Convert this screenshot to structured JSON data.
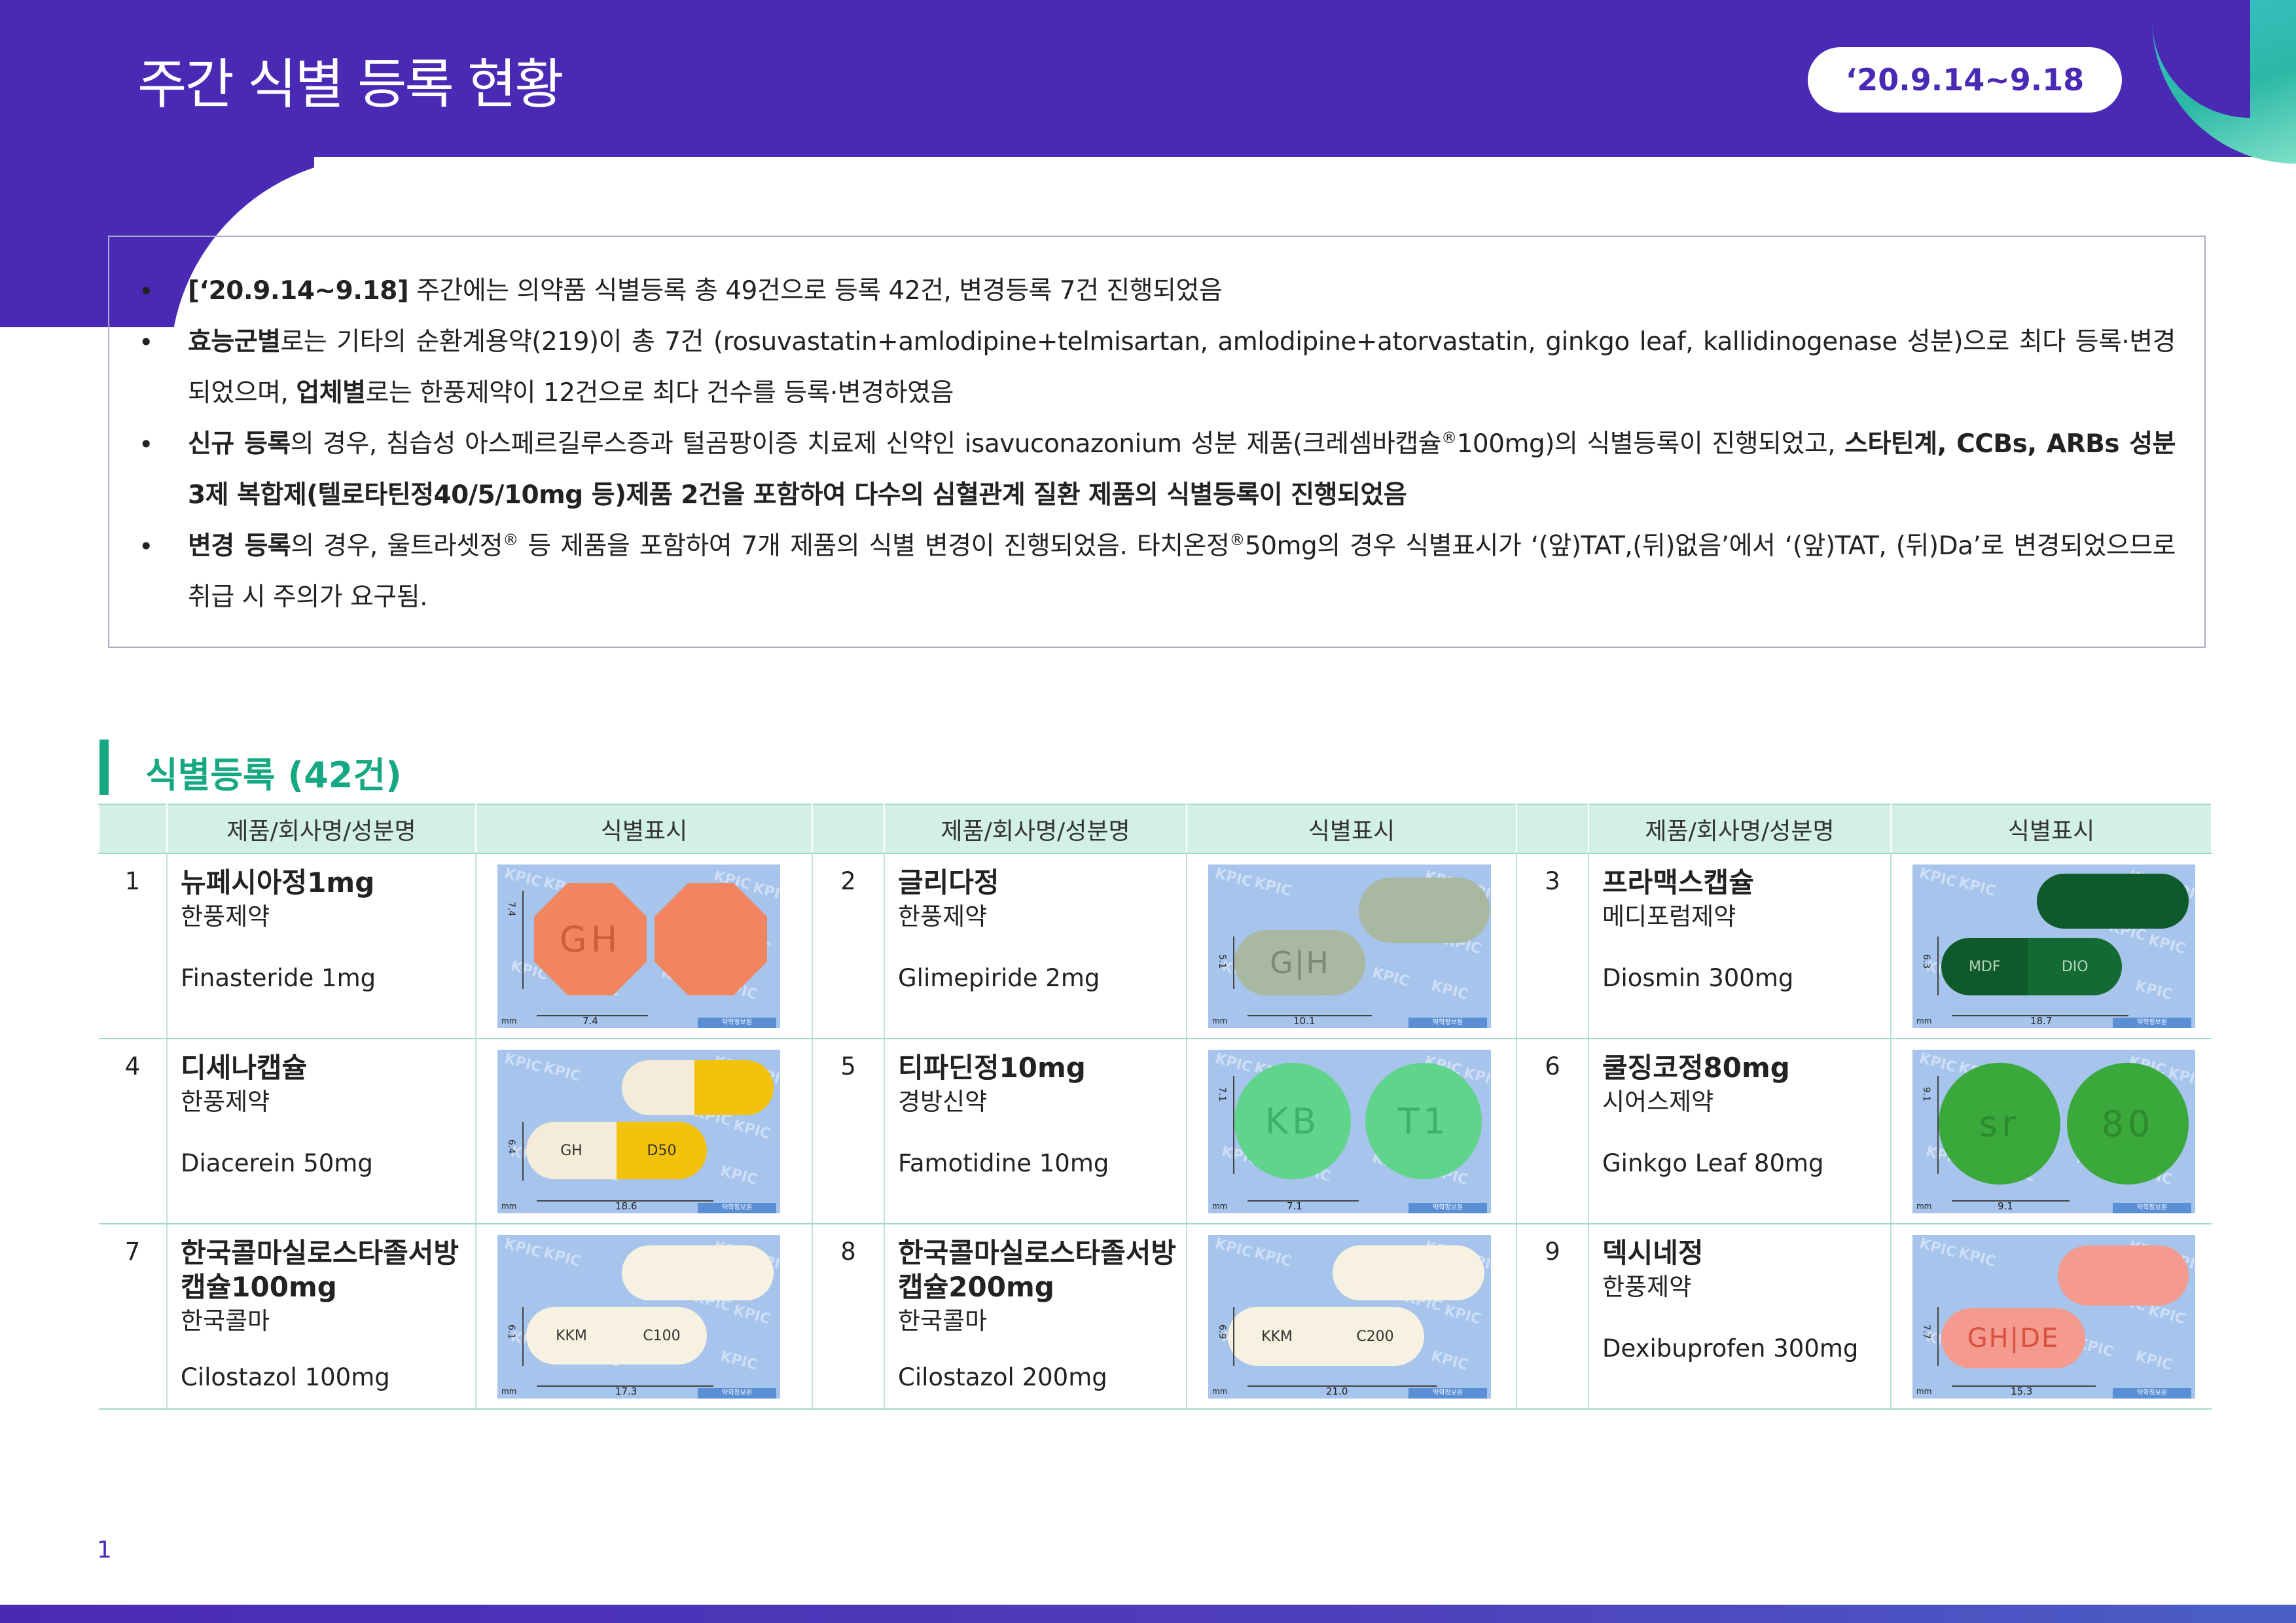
{
  "header": {
    "title": "주간 식별 등록 현황",
    "date_range": "‘20.9.14~9.18"
  },
  "summary": {
    "b1": {
      "bold": "[‘20.9.14~9.18]",
      "text": " 주간에는 의약품 식별등록 총 49건으로 등록 42건, 변경등록 7건 진행되었음"
    },
    "b2": {
      "bold1": "효능군별",
      "text1": "로는 기타의 순환계용약(219)이 총 7건 (rosuvastatin+amlodipine+telmisartan, amlodipine+atorvastatin, ginkgo leaf, kallidinogenase 성분)으로 최다 등록·변경 되었으며, ",
      "bold2": "업체별",
      "text2": "로는 한풍제약이 12건으로 최다 건수를 등록·변경하였음"
    },
    "b3": {
      "bold1": "신규 등록",
      "text1": "의 경우, 침습성 아스페르길루스증과 털곰팡이증 치료제 신약인 isavuconazonium 성분 제품(크레셈바캡슐",
      "sup": "®",
      "text2": "100mg)의 식별등록이 진행되었고, ",
      "bold2": "스타틴계, CCBs, ARBs 성분 3제 복합제(텔로타틴정40/5/10mg 등)제품 2건을 포함하여 다수의 심혈관계 질환 제품의 식별등록이 진행되었음"
    },
    "b4": {
      "bold1": "변경 등록",
      "text1": "의 경우, 울트라셋정",
      "sup1": "®",
      "text2": " 등 제품을 포함하여 7개 제품의 식별 변경이 진행되었음. 타치온정",
      "sup2": "®",
      "text3": "50mg의 경우 식별표시가 ‘(앞)TAT,(뒤)없음’에서 ‘(앞)TAT, (뒤)Da’로 변경되었으므로 취급 시 주의가 요구됨."
    },
    "bullet": "•"
  },
  "section": {
    "title": "식별등록 (42건)"
  },
  "table": {
    "col_product": "제품/회사명/성분명",
    "col_mark": "식별표시",
    "rows": [
      [
        {
          "no": "1",
          "product": "뉴페시아정1mg",
          "company": "한풍제약",
          "ingredient": "Finasteride 1mg",
          "w": "7.4",
          "h": "7.4"
        },
        {
          "no": "2",
          "product": "글리다정",
          "company": "한풍제약",
          "ingredient": "Glimepiride 2mg",
          "w": "10.1",
          "h": "5.1"
        },
        {
          "no": "3",
          "product": "프라맥스캡슐",
          "company": "메디포럼제약",
          "ingredient": "Diosmin 300mg",
          "w": "18.7",
          "h": "6.3"
        }
      ],
      [
        {
          "no": "4",
          "product": "디세나캡슐",
          "company": "한풍제약",
          "ingredient": "Diacerein 50mg",
          "w": "18.6",
          "h": "6.4"
        },
        {
          "no": "5",
          "product": "티파딘정10mg",
          "company": "경방신약",
          "ingredient": "Famotidine 10mg",
          "w": "7.1",
          "h": "7.1"
        },
        {
          "no": "6",
          "product": "쿨징코정80mg",
          "company": "시어스제약",
          "ingredient": "Ginkgo Leaf 80mg",
          "w": "9.1",
          "h": "9.1"
        }
      ],
      [
        {
          "no": "7",
          "product": "한국콜마실로스타졸서방캡슐100mg",
          "company": "한국콜마",
          "ingredient": "Cilostazol 100mg",
          "w": "17.3",
          "h": "6.1"
        },
        {
          "no": "8",
          "product": "한국콜마실로스타졸서방캡슐200mg",
          "company": "한국콜마",
          "ingredient": "Cilostazol 200mg",
          "w": "21.0",
          "h": "6.9"
        },
        {
          "no": "9",
          "product": "덱시네정",
          "company": "한풍제약",
          "ingredient": "Dexibuprofen 300mg",
          "w": "15.3",
          "h": "7.7"
        }
      ]
    ]
  },
  "imprints": {
    "gh": "GH",
    "gh_split": "G|H",
    "mdf": "MDF",
    "dio": "DIO",
    "gh_cap": "GH",
    "d50": "D50",
    "kb": "KB",
    "t1": "T1",
    "sr": "sr",
    "n80": "80",
    "kkm": "KKM",
    "c100": "C100",
    "c200": "C200",
    "ghde": "GH|DE"
  },
  "card": {
    "watermark": "KPIC",
    "mm": "mm",
    "logo": "약학정보원"
  },
  "colors": {
    "header_purple": "#4a2ab4",
    "accent_teal": "#2bb8a6",
    "section_green": "#16a882",
    "table_header_bg": "#d3f0e6",
    "card_bg": "#a6c4ec"
  },
  "page_number": "1"
}
